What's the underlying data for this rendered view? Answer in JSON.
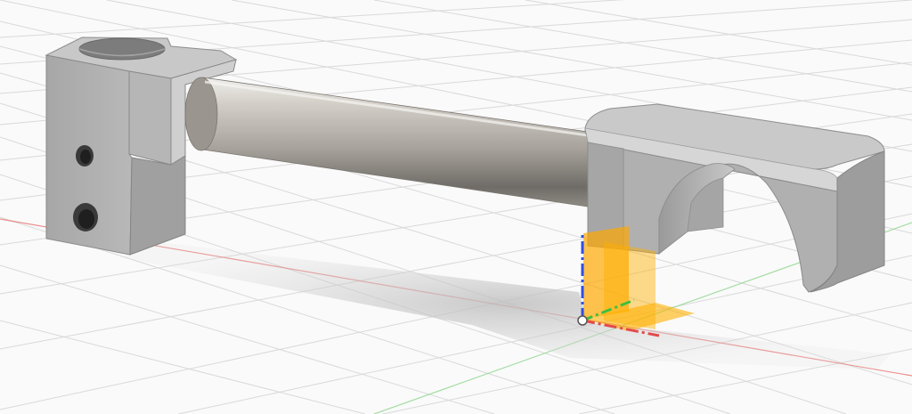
{
  "app": {
    "view_name": "3D CAD viewport"
  },
  "scene": {
    "colors": {
      "background": "#fafafa",
      "grid_line": "#d8d8d8",
      "grid_major": "#c6c6c6",
      "x_axis": "#e34a4a",
      "y_axis": "#3fbf3f",
      "z_axis": "#2f4fe0",
      "part_light": "#bdbdbd",
      "part_mid": "#a9a9a9",
      "part_dark": "#8f8f8f",
      "rod_light": "#d9d6d0",
      "rod_mid": "#a6a29b",
      "rod_dark": "#6f6b66",
      "origin_plane": "#ffb000",
      "shadow": "#c9c9c9"
    },
    "icons": {
      "origin": "origin-icon",
      "axes": "axis-icon"
    }
  }
}
